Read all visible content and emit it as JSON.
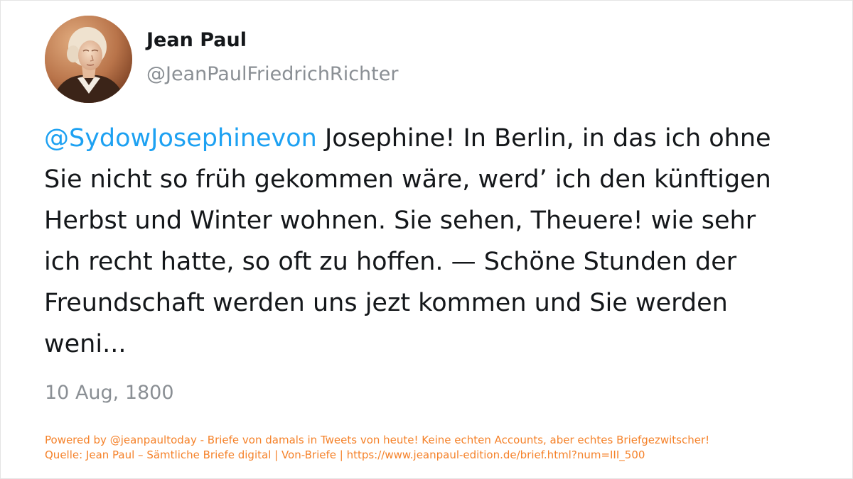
{
  "profile": {
    "display_name": "Jean Paul",
    "handle": "@JeanPaulFriedrichRichter",
    "avatar_icon": "portrait-avatar"
  },
  "tweet": {
    "mention": "@SydowJosephinevon",
    "body": "Josephine! In Berlin, in das ich ohne Sie nicht so früh gekommen wäre, werd’ ich den künftigen Herbst und Winter wohnen. Sie sehen, Theuere! wie sehr ich recht hatte, so oft zu hoffen. — Schöne Stunden der Freundschaft werden uns jezt kommen und Sie werden weni...",
    "date": "10 Aug, 1800"
  },
  "footer": {
    "powered_by": "Powered by @jeanpaultoday - Briefe von damals in Tweets von heute! Keine echten Accounts, aber echtes Briefgezwitscher!",
    "source": "Quelle: Jean Paul – Sämtliche Briefe digital | Von-Briefe | https://www.jeanpaul-edition.de/brief.html?num=III_500"
  },
  "colors": {
    "mention": "#1da1f2",
    "text": "#14171a",
    "muted": "#8a8f94",
    "footer": "#f5822a"
  }
}
